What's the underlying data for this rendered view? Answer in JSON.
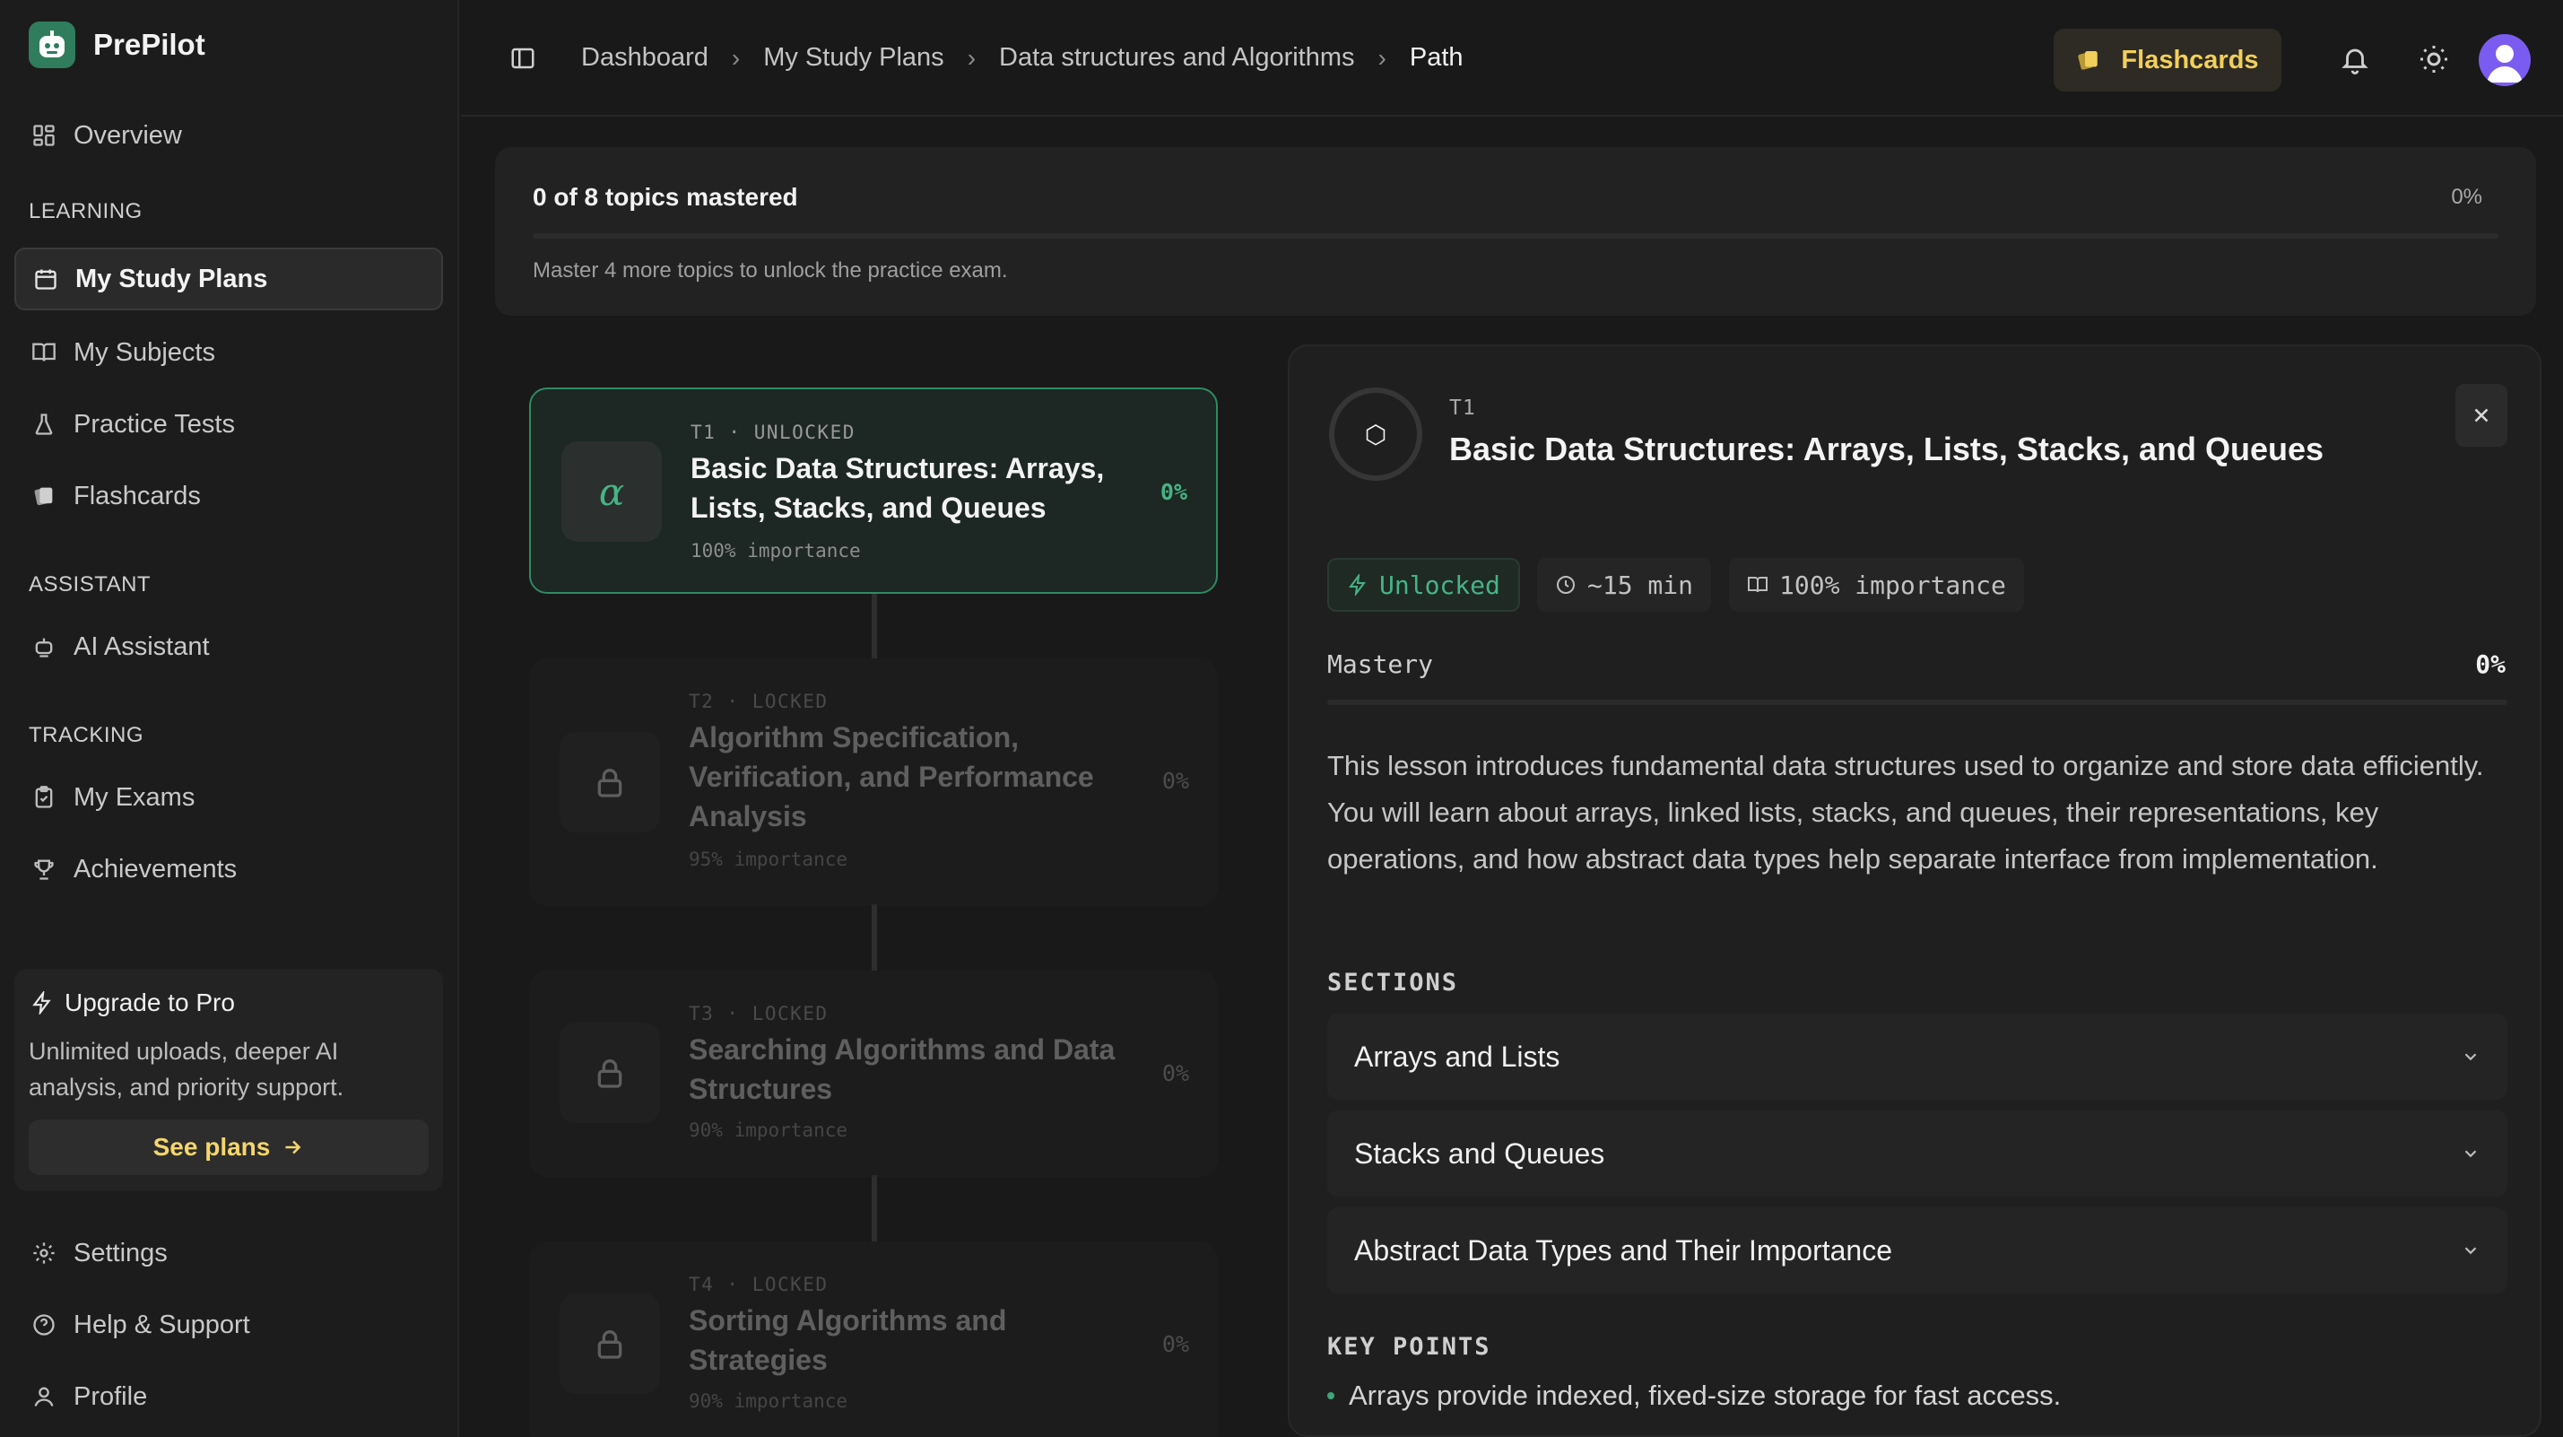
{
  "app": {
    "name": "PrePilot",
    "brand_color": "#2f7d5d",
    "accent_green": "#46b486",
    "accent_yellow": "#f2cf5b"
  },
  "sidebar": {
    "overview": "Overview",
    "sections": {
      "learning": "LEARNING",
      "assistant": "ASSISTANT",
      "tracking": "TRACKING"
    },
    "items": {
      "study_plans": "My Study Plans",
      "subjects": "My Subjects",
      "practice_tests": "Practice Tests",
      "flashcards": "Flashcards",
      "ai_assistant": "AI Assistant",
      "exams": "My Exams",
      "achievements": "Achievements",
      "settings": "Settings",
      "help": "Help & Support",
      "profile": "Profile"
    },
    "upgrade": {
      "title": "Upgrade to Pro",
      "desc": "Unlimited uploads, deeper AI analysis, and priority support.",
      "button": "See plans"
    }
  },
  "topbar": {
    "breadcrumbs": [
      "Dashboard",
      "My Study Plans",
      "Data structures and Algorithms",
      "Path"
    ],
    "flashcards_button": "Flashcards"
  },
  "progress": {
    "title": "0 of 8 topics mastered",
    "percent": "0%",
    "value": 0,
    "desc": "Master 4 more topics to unlock the practice exam."
  },
  "topics": [
    {
      "meta": "T1 · UNLOCKED",
      "icon": "α",
      "title": "Basic Data Structures: Arrays, Lists, Stacks, and Queues",
      "importance": "100% importance",
      "pct": "0%"
    },
    {
      "meta": "T2 · LOCKED",
      "title": "Algorithm Specification, Verification, and Performance Analysis",
      "importance": "95% importance",
      "pct": "0%"
    },
    {
      "meta": "T3 · LOCKED",
      "title": "Searching Algorithms and Data Structures",
      "importance": "90% importance",
      "pct": "0%"
    },
    {
      "meta": "T4 · LOCKED",
      "title": "Sorting Algorithms and Strategies",
      "importance": "90% importance",
      "pct": "0%"
    }
  ],
  "detail": {
    "code": "T1",
    "ring_glyph": "⬡",
    "title": "Basic Data Structures: Arrays, Lists, Stacks, and Queues",
    "chips": {
      "status": "Unlocked",
      "time": "~15 min",
      "importance": "100% importance"
    },
    "mastery_label": "Mastery",
    "mastery_value": "0%",
    "mastery_fraction": 0,
    "description": "This lesson introduces fundamental data structures used to organize and store data efficiently. You will learn about arrays, linked lists, stacks, and queues, their representations, key operations, and how abstract data types help separate interface from implementation.",
    "sections_heading": "SECTIONS",
    "sections": [
      "Arrays and Lists",
      "Stacks and Queues",
      "Abstract Data Types and Their Importance"
    ],
    "key_points_heading": "KEY POINTS",
    "key_points": [
      "Arrays provide indexed, fixed-size storage for fast access."
    ]
  }
}
